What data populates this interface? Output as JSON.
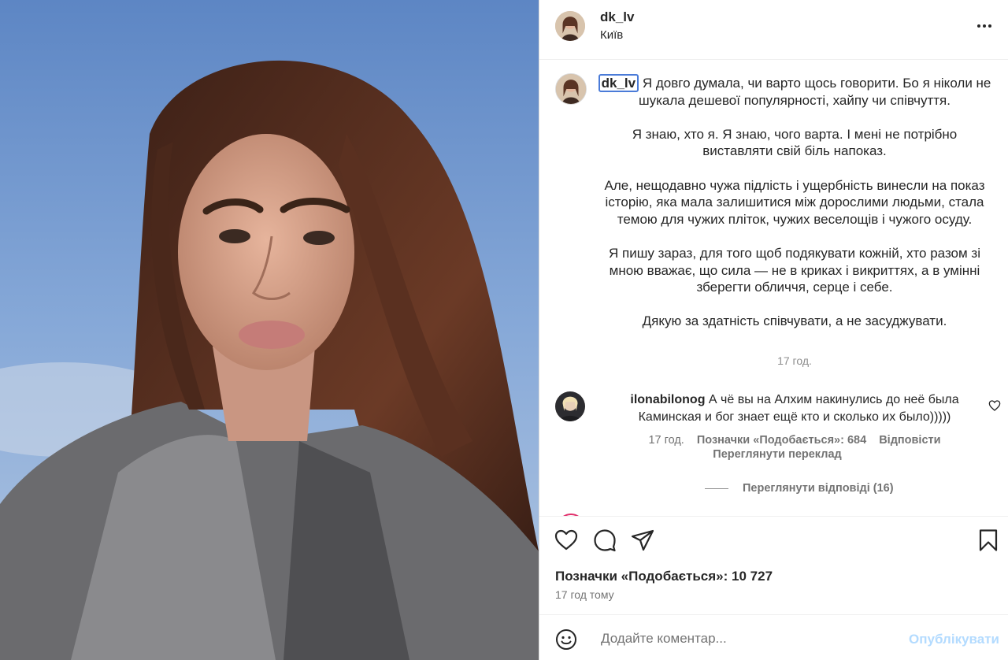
{
  "post": {
    "username": "dk_lv",
    "location": "Київ"
  },
  "caption": {
    "username": "dk_lv",
    "paragraphs": [
      "Я довго думала, чи варто щось говорити. Бо я ніколи не шукала дешевої популярності, хайпу чи співчуття.",
      "Я знаю, хто я. Я знаю, чого варта. І мені не потрібно виставляти свій біль напоказ.",
      "Але, нещодавно чужа підлість і ущербність винесли на показ історію, яка мала залишитися між дорослими людьми, стала темою для чужих пліток, чужих веселощів і чужого осуду.",
      "Я пишу зараз, для того щоб подякувати кожній, хто разом зі мною вважає, що сила — не в криках і викриттях, а в умінні зберегти обличчя, серце і себе.",
      "Дякую за здатність співчувати, а не засуджувати."
    ],
    "time": "17 год."
  },
  "comment": {
    "username": "ilonabilonog",
    "text": "А чё вы на Алхим накинулись до неё была Каминская и бог знает ещё кто и сколько их было)))))",
    "time": "17 год.",
    "likes": "Позначки «Подобається»: 684",
    "reply": "Відповісти",
    "translate": "Переглянути переклад",
    "view_replies": "Переглянути відповіді (16)"
  },
  "actions": {
    "likes_count": "Позначки «Подобається»: 10 727",
    "posted_ago": "17 год тому"
  },
  "add_comment": {
    "placeholder": "Додайте коментар...",
    "publish": "Опублікувати"
  },
  "icons": {
    "more": "more-horizontal-icon",
    "like": "heart-icon",
    "comment": "comment-icon",
    "share": "paper-plane-icon",
    "save": "bookmark-icon",
    "emoji": "emoji-icon"
  },
  "colors": {
    "accent": "#0095f6",
    "publish_disabled": "#b3dbff",
    "muted": "#737373",
    "text": "#262626"
  }
}
